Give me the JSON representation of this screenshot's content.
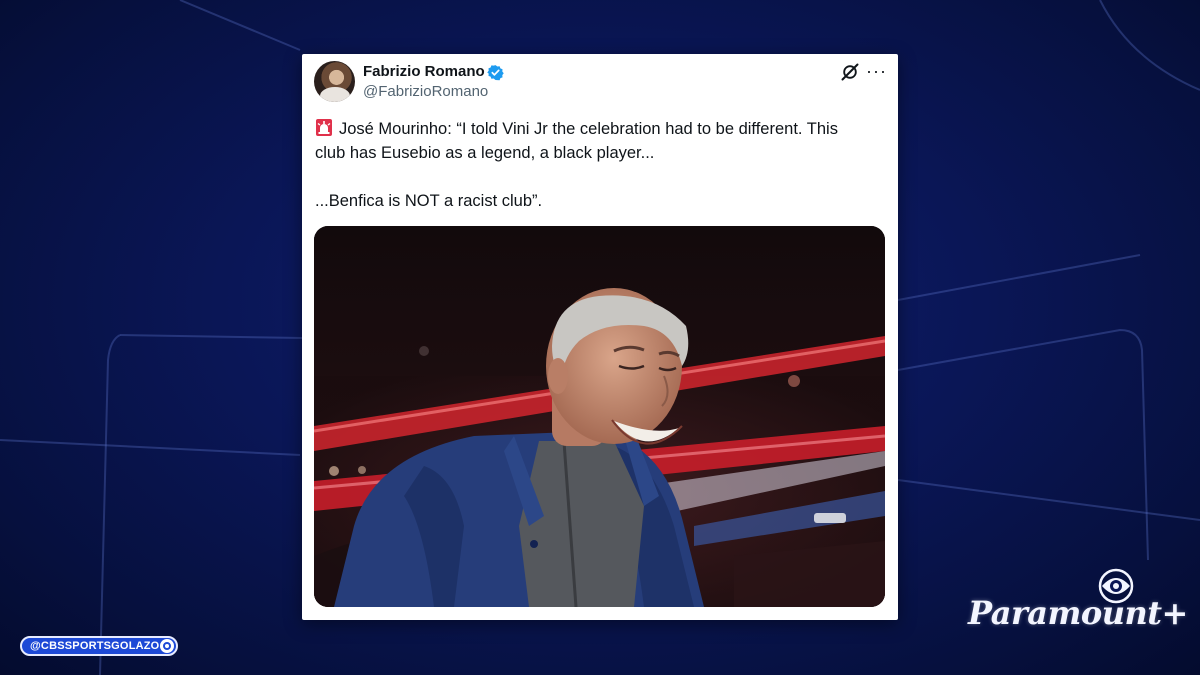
{
  "tweet": {
    "author_name": "Fabrizio Romano",
    "author_handle": "@FabrizioRomano",
    "more_glyph": "···",
    "text_line_1": "José Mourinho: “I told Vini Jr the celebration had to be different. This",
    "text_line_2": "club has Eusebio as a legend, a black player...",
    "text_line_3": "...Benfica is NOT a racist club”.",
    "leading_icon": "police-siren-icon",
    "verified_color": "#1d9bf0"
  },
  "broadcast": {
    "social_handle": "@CBSSPORTSGOLAZO",
    "brand": "Paramount+",
    "accent_color": "#1d49d6"
  }
}
